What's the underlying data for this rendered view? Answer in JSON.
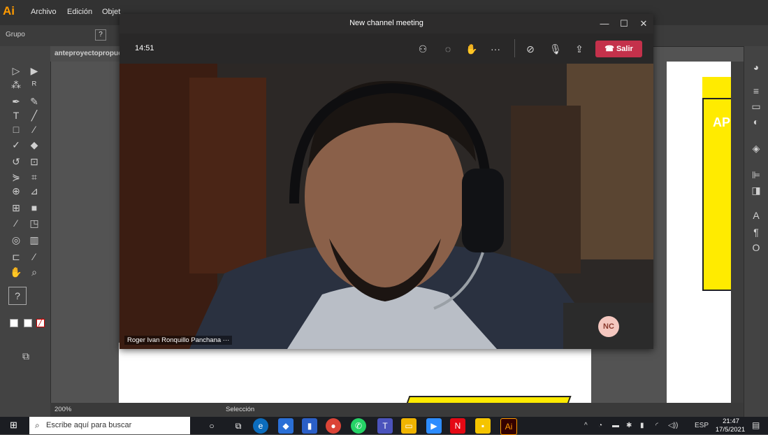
{
  "illustrator": {
    "logo": "Ai",
    "menus": [
      "Archivo",
      "Edición",
      "Objet"
    ],
    "control_bar_label": "Grupo",
    "help_glyph": "?",
    "document_tab": "anteproyectopropue",
    "zoom": "200%",
    "status_tool": "Selección",
    "artboard_text": "AP"
  },
  "teams": {
    "window_title": "New channel meeting",
    "timer": "14:51",
    "leave_label": "Salir",
    "participant_name": "Roger Ivan Ronquillo Panchana",
    "participant_more": "···",
    "self_initials": "NC",
    "accent_leave": "#c4314b"
  },
  "taskbar": {
    "search_placeholder": "Escribe aquí para buscar",
    "language": "ESP",
    "time": "21:47",
    "date": "17/5/2021"
  }
}
